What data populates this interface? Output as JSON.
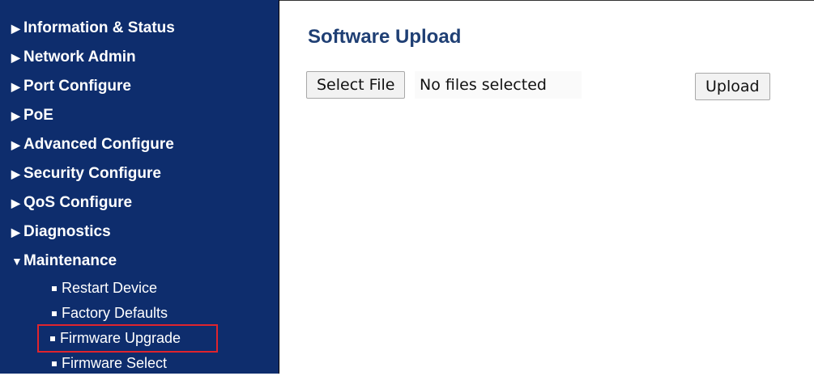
{
  "sidebar": {
    "items": [
      {
        "label": "Information & Status",
        "expanded": false
      },
      {
        "label": "Network Admin",
        "expanded": false
      },
      {
        "label": "Port Configure",
        "expanded": false
      },
      {
        "label": "PoE",
        "expanded": false
      },
      {
        "label": "Advanced Configure",
        "expanded": false
      },
      {
        "label": "Security Configure",
        "expanded": false
      },
      {
        "label": "QoS Configure",
        "expanded": false
      },
      {
        "label": "Diagnostics",
        "expanded": false
      },
      {
        "label": "Maintenance",
        "expanded": true
      }
    ],
    "maintenance_children": [
      {
        "label": "Restart Device"
      },
      {
        "label": "Factory Defaults"
      },
      {
        "label": "Firmware Upgrade",
        "highlighted": true
      },
      {
        "label": "Firmware Select"
      }
    ],
    "arrow_collapsed": "▶",
    "arrow_expanded": "▼"
  },
  "main": {
    "title": "Software Upload",
    "select_file_label": "Select File",
    "file_status": "No files selected",
    "upload_label": "Upload"
  },
  "colors": {
    "sidebar_bg": "#0e2d6d",
    "title": "#1f3f74",
    "highlight_box": "#e0242d"
  }
}
